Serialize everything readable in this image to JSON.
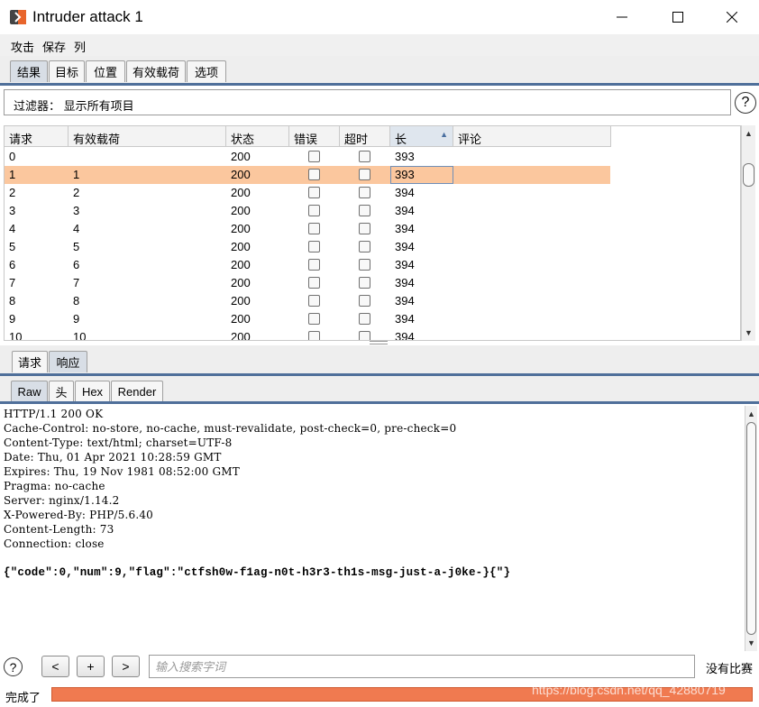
{
  "window": {
    "title": "Intruder attack 1"
  },
  "menu": {
    "items": [
      "攻击",
      "保存",
      "列"
    ]
  },
  "main_tabs": [
    "结果",
    "目标",
    "位置",
    "有效载荷",
    "选项"
  ],
  "filter": {
    "text": "过滤器： 显示所有项目",
    "help_icon": "?"
  },
  "table": {
    "columns": [
      "请求",
      "有效载荷",
      "状态",
      "错误",
      "超时",
      "长",
      "评论"
    ],
    "sort_indicator": "▲",
    "rows": [
      {
        "request": "0",
        "payload": "",
        "status": "200",
        "length": "393"
      },
      {
        "request": "1",
        "payload": "1",
        "status": "200",
        "length": "393"
      },
      {
        "request": "2",
        "payload": "2",
        "status": "200",
        "length": "394"
      },
      {
        "request": "3",
        "payload": "3",
        "status": "200",
        "length": "394"
      },
      {
        "request": "4",
        "payload": "4",
        "status": "200",
        "length": "394"
      },
      {
        "request": "5",
        "payload": "5",
        "status": "200",
        "length": "394"
      },
      {
        "request": "6",
        "payload": "6",
        "status": "200",
        "length": "394"
      },
      {
        "request": "7",
        "payload": "7",
        "status": "200",
        "length": "394"
      },
      {
        "request": "8",
        "payload": "8",
        "status": "200",
        "length": "394"
      },
      {
        "request": "9",
        "payload": "9",
        "status": "200",
        "length": "394"
      },
      {
        "request": "10",
        "payload": "10",
        "status": "200",
        "length": "394"
      }
    ]
  },
  "detail_tabs": [
    "请求",
    "响应"
  ],
  "view_tabs": [
    "Raw",
    "头",
    "Hex",
    "Render"
  ],
  "response": {
    "lines": [
      "HTTP/1.1 200 OK",
      "Cache-Control: no-store, no-cache, must-revalidate, post-check=0, pre-check=0",
      "Content-Type: text/html; charset=UTF-8",
      "Date: Thu, 01 Apr 2021 10:28:59 GMT",
      "Expires: Thu, 19 Nov 1981 08:52:00 GMT",
      "Pragma: no-cache",
      "Server: nginx/1.14.2",
      "X-Powered-By: PHP/5.6.40",
      "Content-Length: 73",
      "Connection: close"
    ],
    "body": "{\"code\":0,\"num\":9,\"flag\":\"ctfsh0w-f1ag-n0t-h3r3-th1s-msg-just-a-j0ke-}{\"}"
  },
  "search": {
    "help_icon": "?",
    "prev_label": "<",
    "add_label": "+",
    "next_label": ">",
    "placeholder": "输入搜索字词",
    "match_status": "没有比赛"
  },
  "status": {
    "text": "完成了",
    "progress": 1.0,
    "watermark": "https://blog.csdn.net/qq_42880719"
  },
  "colors": {
    "selected_row": "#fbc79e",
    "progress": "#f07a50",
    "tab_accent": "#4f6f9a"
  }
}
